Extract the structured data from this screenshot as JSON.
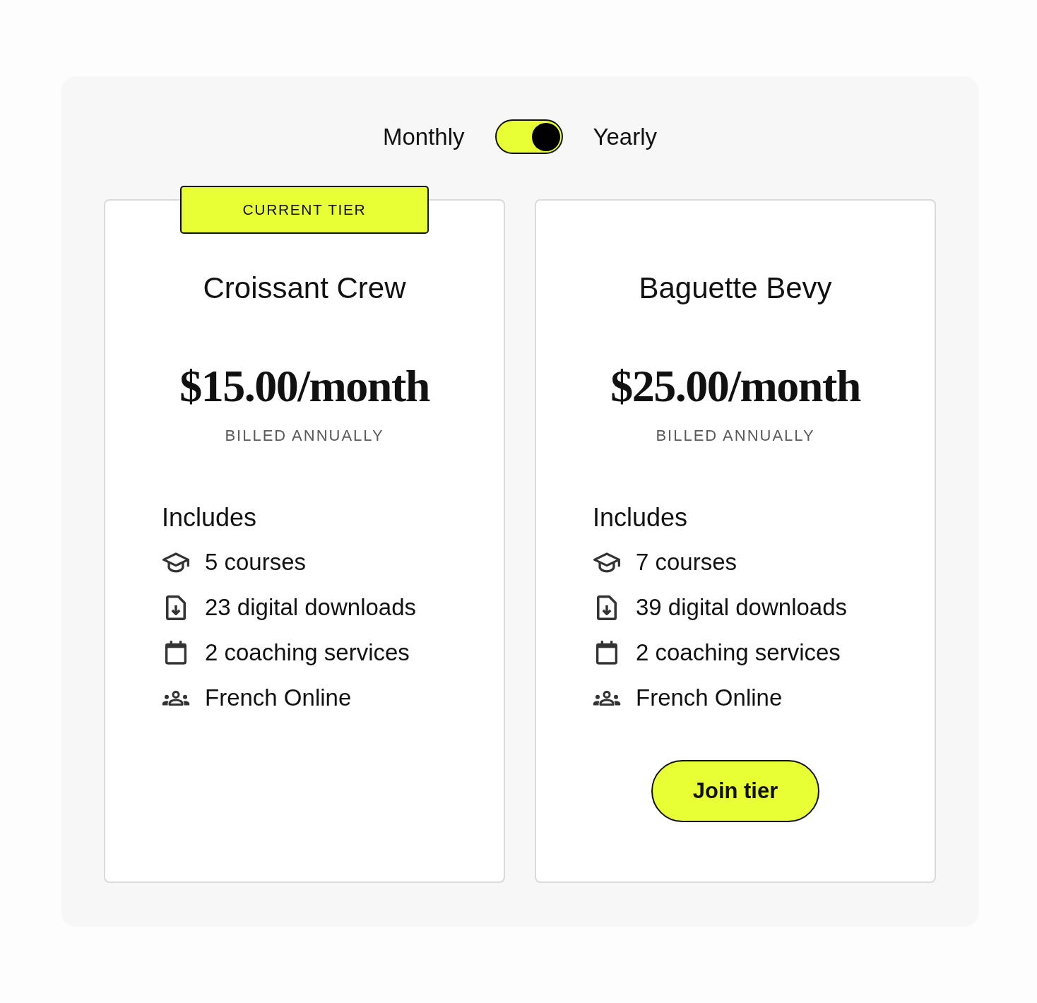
{
  "billing_toggle": {
    "off_label": "Monthly",
    "on_label": "Yearly",
    "on": true
  },
  "tiers": [
    {
      "badge": "CURRENT TIER",
      "name": "Croissant Crew",
      "price": "$15.00/month",
      "billing": "BILLED ANNUALLY",
      "includes_label": "Includes",
      "features": [
        {
          "kind": "course",
          "text": "5 courses"
        },
        {
          "kind": "download",
          "text": "23 digital downloads"
        },
        {
          "kind": "calendar",
          "text": "2 coaching services"
        },
        {
          "kind": "group",
          "text": "French Online"
        }
      ]
    },
    {
      "name": "Baguette Bevy",
      "price": "$25.00/month",
      "billing": "BILLED ANNUALLY",
      "includes_label": "Includes",
      "features": [
        {
          "kind": "course",
          "text": "7 courses"
        },
        {
          "kind": "download",
          "text": "39 digital downloads"
        },
        {
          "kind": "calendar",
          "text": "2 coaching services"
        },
        {
          "kind": "group",
          "text": "French Online"
        }
      ],
      "button": "Join tier"
    }
  ]
}
